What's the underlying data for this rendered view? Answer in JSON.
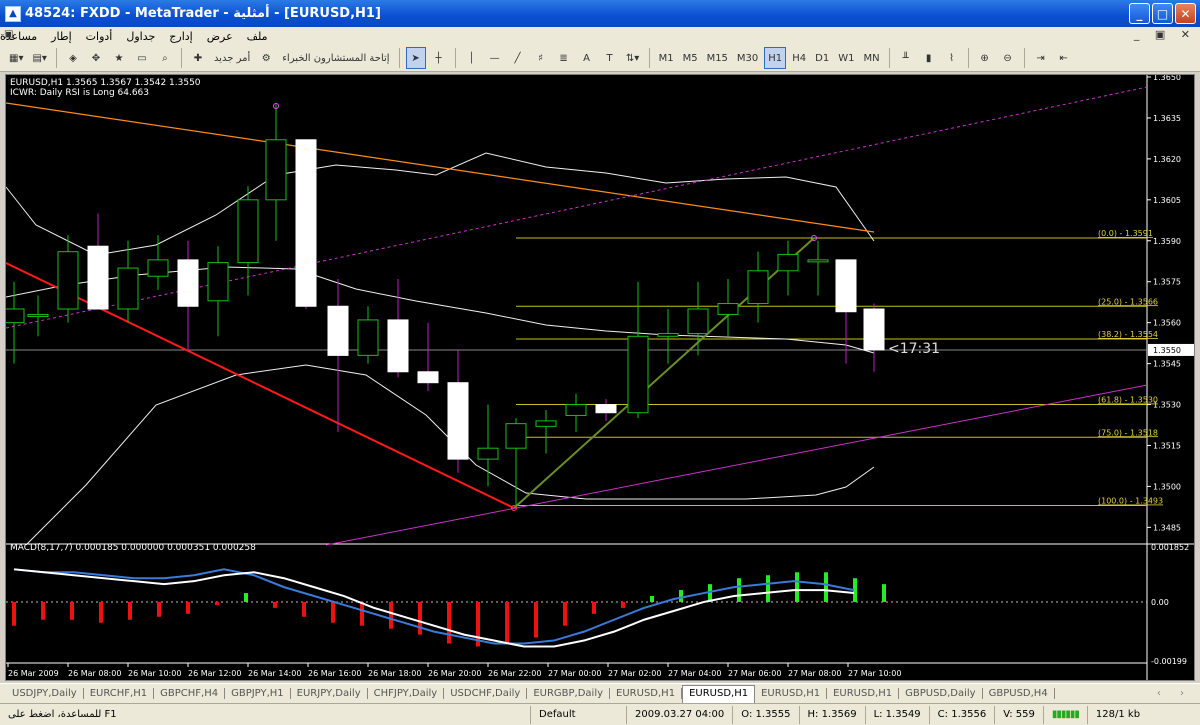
{
  "window": {
    "title": "48524: FXDD - MetaTrader - أمثلية - [EURUSD,H1]"
  },
  "menu": [
    "ملف",
    "عرض",
    "إدارج",
    "جداول",
    "أدوات",
    "إطار",
    "مساعدة"
  ],
  "toolbar": {
    "new_order": "أمر جديد",
    "experts": "إتاحة المستشارون الخبراء",
    "timeframes": [
      "M1",
      "M5",
      "M15",
      "M30",
      "H1",
      "H4",
      "D1",
      "W1",
      "MN"
    ],
    "active_tf": "H1"
  },
  "chart": {
    "header": "EURUSD,H1  1.3565 1.3567 1.3542 1.3550",
    "indicator_note": "ICWR: Daily RSI is Long 64.663",
    "countdown": "<17:31",
    "current_price": "1.3550",
    "price_axis": [
      "1.3650",
      "1.3635",
      "1.3620",
      "1.3605",
      "1.3590",
      "1.3575",
      "1.3560",
      "1.3545",
      "1.3530",
      "1.3515",
      "1.3500",
      "1.3485"
    ],
    "fib_levels": [
      {
        "label": "(0.0) - 1.3591",
        "price": 1.3591
      },
      {
        "label": "(25.0) - 1.3566",
        "price": 1.3566
      },
      {
        "label": "(38.2) - 1.3554",
        "price": 1.3554
      },
      {
        "label": "(61.8) - 1.3530",
        "price": 1.353
      },
      {
        "label": "(75.0) - 1.3518",
        "price": 1.3518
      },
      {
        "label": "(100.0) - 1.3493",
        "price": 1.3493
      }
    ],
    "time_axis": [
      "26 Mar 2009",
      "26 Mar 08:00",
      "26 Mar 10:00",
      "26 Mar 12:00",
      "26 Mar 14:00",
      "26 Mar 16:00",
      "26 Mar 18:00",
      "26 Mar 20:00",
      "26 Mar 22:00",
      "27 Mar 00:00",
      "27 Mar 02:00",
      "27 Mar 04:00",
      "27 Mar 06:00",
      "27 Mar 08:00",
      "27 Mar 10:00"
    ],
    "macd_header": "MACD(8,17,7) 0.000185 0.000000 0.000351 0.000258",
    "macd_axis": [
      "0.001852",
      "0.00",
      "-0.00199"
    ]
  },
  "tabs": [
    "USDJPY,Daily",
    "EURCHF,H1",
    "GBPCHF,H4",
    "GBPJPY,H1",
    "EURJPY,Daily",
    "CHFJPY,Daily",
    "USDCHF,Daily",
    "EURGBP,Daily",
    "EURUSD,H1",
    "EURUSD,H1",
    "EURUSD,H1",
    "EURUSD,H1",
    "GBPUSD,Daily",
    "GBPUSD,H4"
  ],
  "active_tab_index": 9,
  "status": {
    "help": "للمساعدة، اضغط على F1",
    "profile": "Default",
    "datetime": "2009.03.27 04:00",
    "open": "O: 1.3555",
    "high": "H: 1.3569",
    "low": "L: 1.3549",
    "close": "C: 1.3556",
    "volume": "V: 559",
    "traffic": "128/1 kb"
  }
}
